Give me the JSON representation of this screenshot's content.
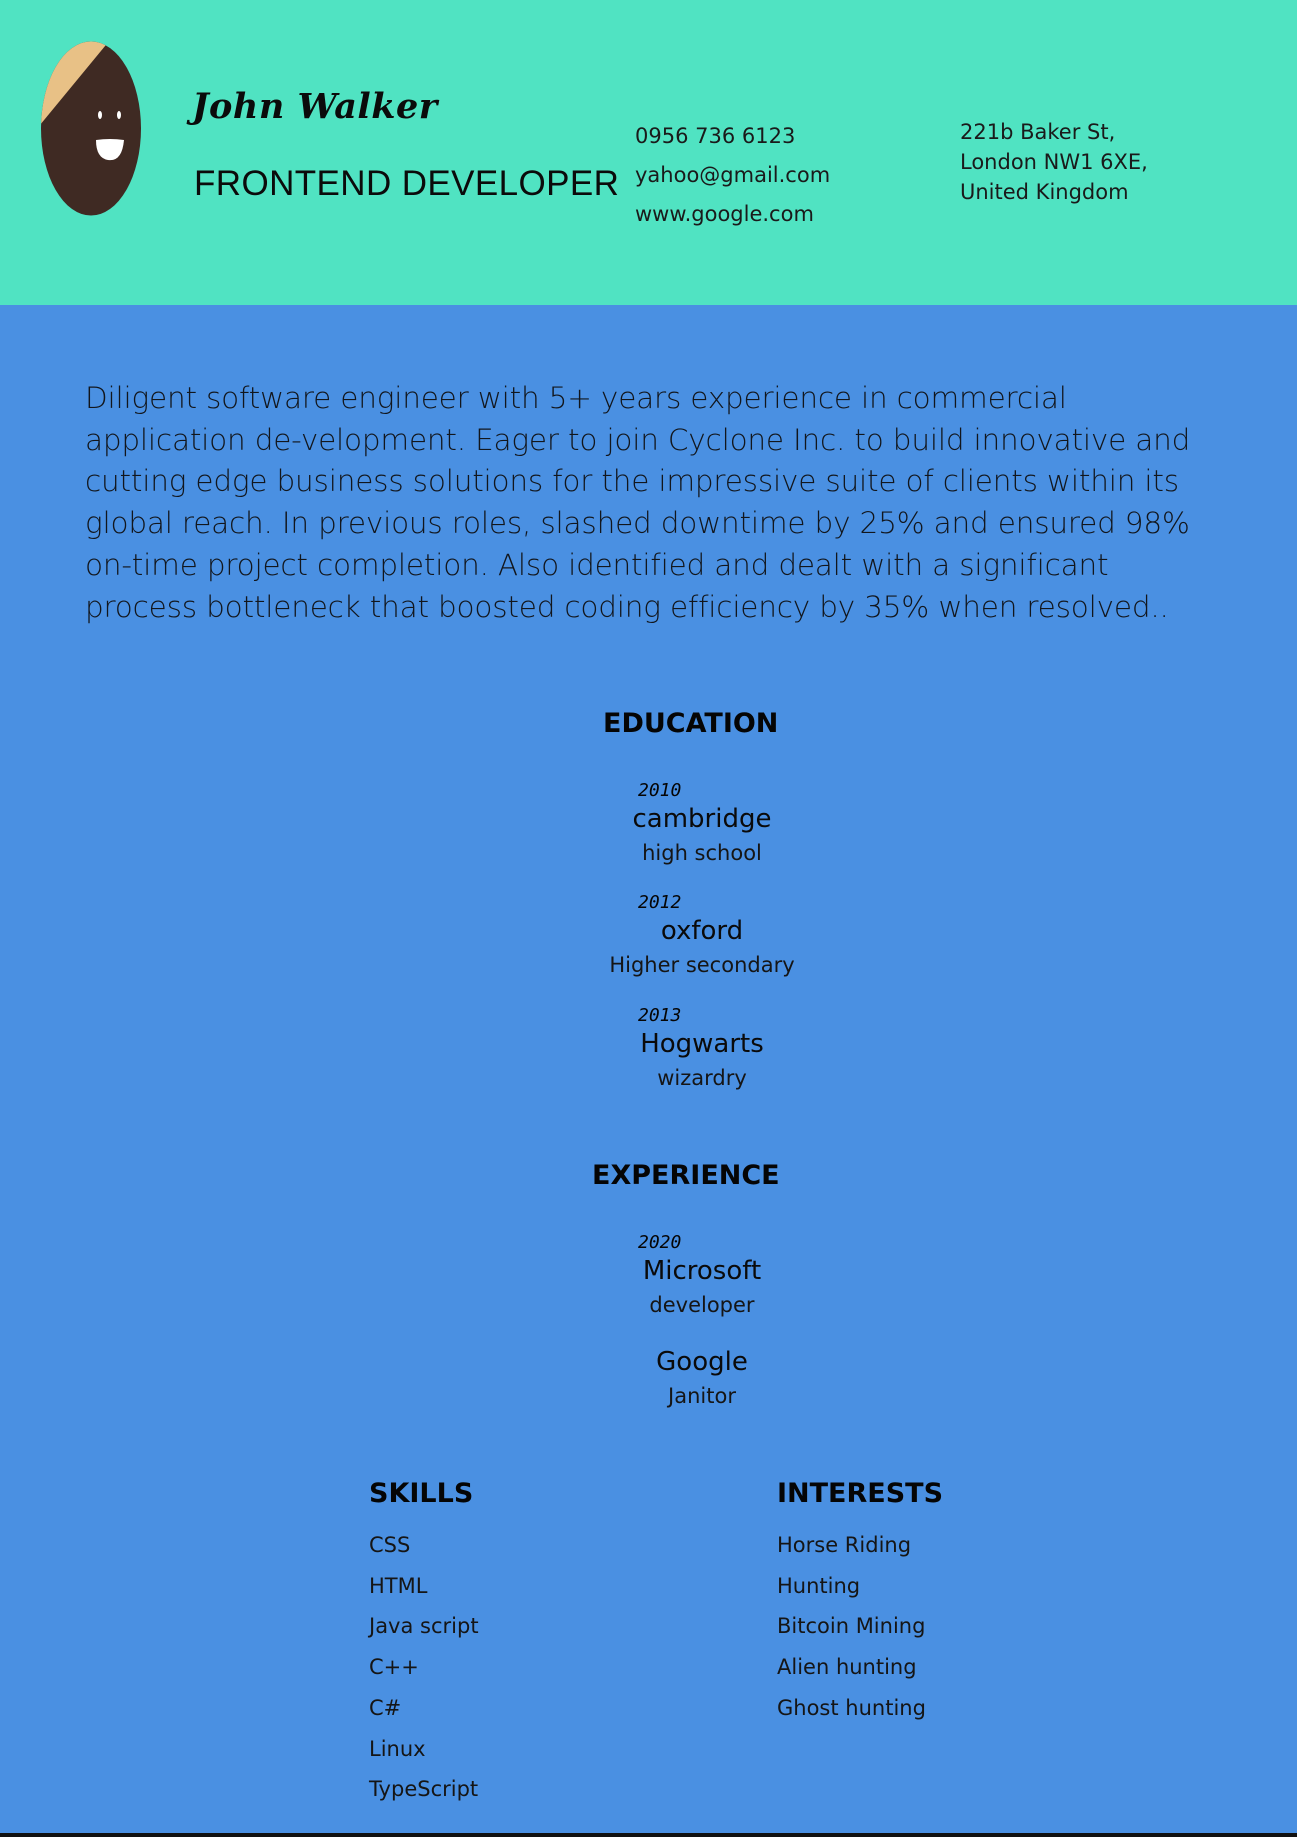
{
  "header": {
    "name": "John Walker",
    "role": "FRONTEND DEVELOPER",
    "contact": [
      "0956 736 6123",
      "yahoo@gmail.com",
      "www.google.com"
    ],
    "address": [
      "221b Baker St,",
      "London NW1 6XE,",
      "United Kingdom"
    ],
    "avatar_icon": "smiley-face-avatar-icon"
  },
  "summary": "Diligent software engineer with 5+ years experience in commercial application de-velopment. Eager to join Cyclone Inc. to build innovative and cutting edge business solutions for the impressive suite of clients within its global reach. In previous roles, slashed downtime by 25% and ensured 98% on-time project completion. Also identified and dealt with a significant process bottleneck that boosted coding efficiency by 35% when resolved..",
  "education": {
    "title": "EDUCATION",
    "items": [
      {
        "year": "2010",
        "place": "cambridge",
        "detail": "high school"
      },
      {
        "year": "2012",
        "place": "oxford",
        "detail": "Higher secondary"
      },
      {
        "year": "2013",
        "place": "Hogwarts",
        "detail": "wizardry"
      }
    ]
  },
  "experience": {
    "title": "EXPERIENCE",
    "items": [
      {
        "year": "2020",
        "place": "Microsoft",
        "detail": "developer"
      },
      {
        "year": "",
        "place": "Google",
        "detail": "Janitor"
      }
    ]
  },
  "skills": {
    "title": "SKILLS",
    "items": [
      "CSS",
      "HTML",
      "Java script",
      "C++",
      "C#",
      "Linux",
      "TypeScript"
    ]
  },
  "interests": {
    "title": "INTERESTS",
    "items": [
      "Horse Riding",
      "Hunting",
      "Bitcoin Mining",
      "Alien hunting",
      "Ghost hunting"
    ]
  },
  "colors": {
    "header_bg": "#50e3c2",
    "body_bg": "#4a90e2",
    "avatar_face": "#3f2a23",
    "avatar_hair": "#e8c186"
  }
}
